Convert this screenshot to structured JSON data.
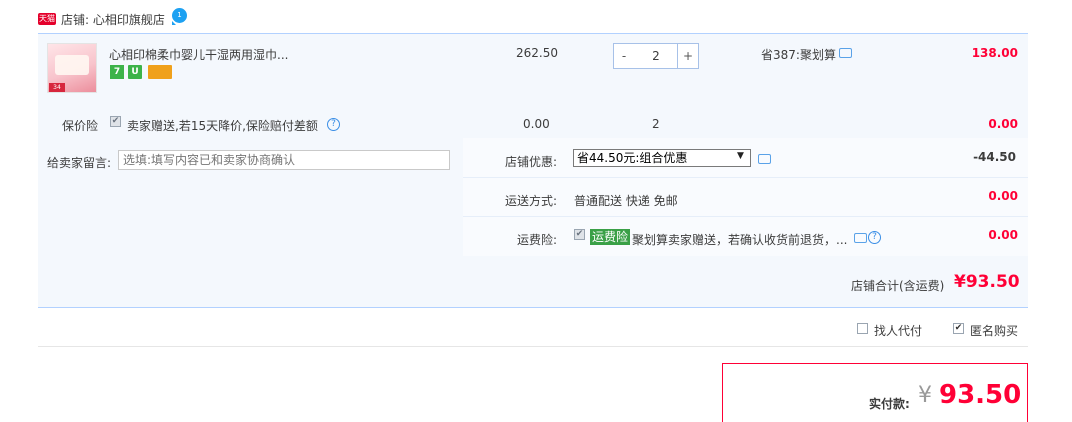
{
  "store": {
    "badge": "天猫",
    "label": "店铺: 心相印旗舰店",
    "chat_badge": "1"
  },
  "item": {
    "title": "心相印棉柔巾婴儿干湿两用湿巾...",
    "thumb_tag": "34",
    "service_icons": [
      "7",
      "U",
      ""
    ],
    "price": "262.50",
    "qty_minus": "-",
    "qty": "2",
    "qty_plus": "+",
    "promo": "省387:聚划算",
    "amount": "138.00"
  },
  "insurance": {
    "label": "保价险",
    "text": "卖家赠送,若15天降价,保险赔付差额",
    "help": "?",
    "price": "0.00",
    "qty": "2",
    "amount": "0.00"
  },
  "message": {
    "label": "给卖家留言:",
    "placeholder": "选填:填写内容已和卖家协商确认"
  },
  "discount": {
    "label": "店铺优惠:",
    "selected": "省44.50元:组合优惠",
    "arrow": "▼",
    "amount": "-44.50"
  },
  "shipping": {
    "label": "运送方式:",
    "text": "普通配送 快递 免邮",
    "amount": "0.00"
  },
  "freight_insurance": {
    "label": "运费险:",
    "tag": "运费险",
    "text": "聚划算卖家赠送，若确认收货前退货，...",
    "help": "?",
    "amount": "0.00"
  },
  "store_total": {
    "label": "店铺合计(含运费)",
    "amount": "¥93.50"
  },
  "options": {
    "proxy_pay": "找人代付",
    "anonymous": "匿名购买",
    "check_mark": "✔"
  },
  "payment": {
    "label": "实付款:",
    "currency": "¥",
    "amount": "93.50"
  },
  "colors": {
    "accent": "#ff0036",
    "panel": "#f4f8fd",
    "border": "#b2d1ff"
  }
}
